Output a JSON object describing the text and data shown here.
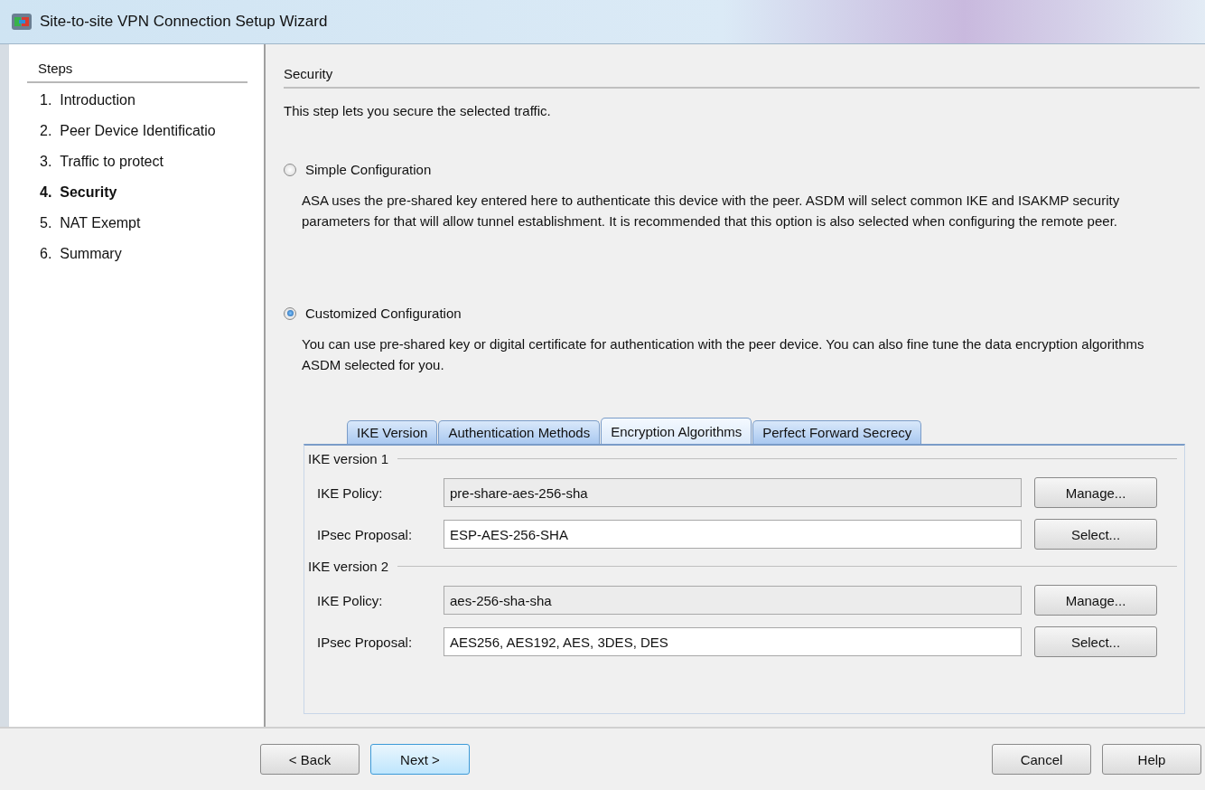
{
  "window": {
    "title": "Site-to-site VPN Connection Setup Wizard"
  },
  "sidebar": {
    "heading": "Steps",
    "items": [
      {
        "number": "1.",
        "label": "Introduction",
        "selected": false
      },
      {
        "number": "2.",
        "label": "Peer Device Identificatio",
        "selected": false
      },
      {
        "number": "3.",
        "label": "Traffic to protect",
        "selected": false
      },
      {
        "number": "4.",
        "label": "Security",
        "selected": true
      },
      {
        "number": "5.",
        "label": "NAT Exempt",
        "selected": false
      },
      {
        "number": "6.",
        "label": "Summary",
        "selected": false
      }
    ]
  },
  "page": {
    "heading": "Security",
    "intro": "This step lets you secure the selected traffic.",
    "options": [
      {
        "label": "Simple Configuration",
        "selected": false,
        "description": "ASA uses the pre-shared key entered here to authenticate this device with the peer. ASDM will select common IKE and ISAKMP security parameters for that will allow tunnel establishment. It is recommended that this option is also selected when configuring the remote peer."
      },
      {
        "label": "Customized Configuration",
        "selected": true,
        "description": "You can use pre-shared key or digital certificate for authentication with the peer device. You can also fine tune the data encryption algorithms ASDM selected for you."
      }
    ]
  },
  "tabs": [
    {
      "label": "IKE Version",
      "selected": false
    },
    {
      "label": "Authentication Methods",
      "selected": false
    },
    {
      "label": "Encryption Algorithms",
      "selected": true
    },
    {
      "label": "Perfect Forward Secrecy",
      "selected": false
    }
  ],
  "groups": [
    {
      "title": "IKE version 1",
      "rows": [
        {
          "label": "IKE Policy:",
          "value": "pre-share-aes-256-sha",
          "readonly": true,
          "button": "Manage..."
        },
        {
          "label": "IPsec Proposal:",
          "value": "ESP-AES-256-SHA",
          "readonly": false,
          "button": "Select..."
        }
      ]
    },
    {
      "title": "IKE version 2",
      "rows": [
        {
          "label": "IKE Policy:",
          "value": "aes-256-sha-sha",
          "readonly": true,
          "button": "Manage..."
        },
        {
          "label": "IPsec Proposal:",
          "value": "AES256, AES192, AES, 3DES, DES",
          "readonly": false,
          "button": "Select..."
        }
      ]
    }
  ],
  "buttons": [
    {
      "label": "< Back",
      "kind": "nav",
      "default": false
    },
    {
      "label": "Next >",
      "kind": "nav",
      "default": true
    },
    {
      "label": "Cancel",
      "kind": "end",
      "default": false
    },
    {
      "label": "Help",
      "kind": "end",
      "default": false
    }
  ]
}
